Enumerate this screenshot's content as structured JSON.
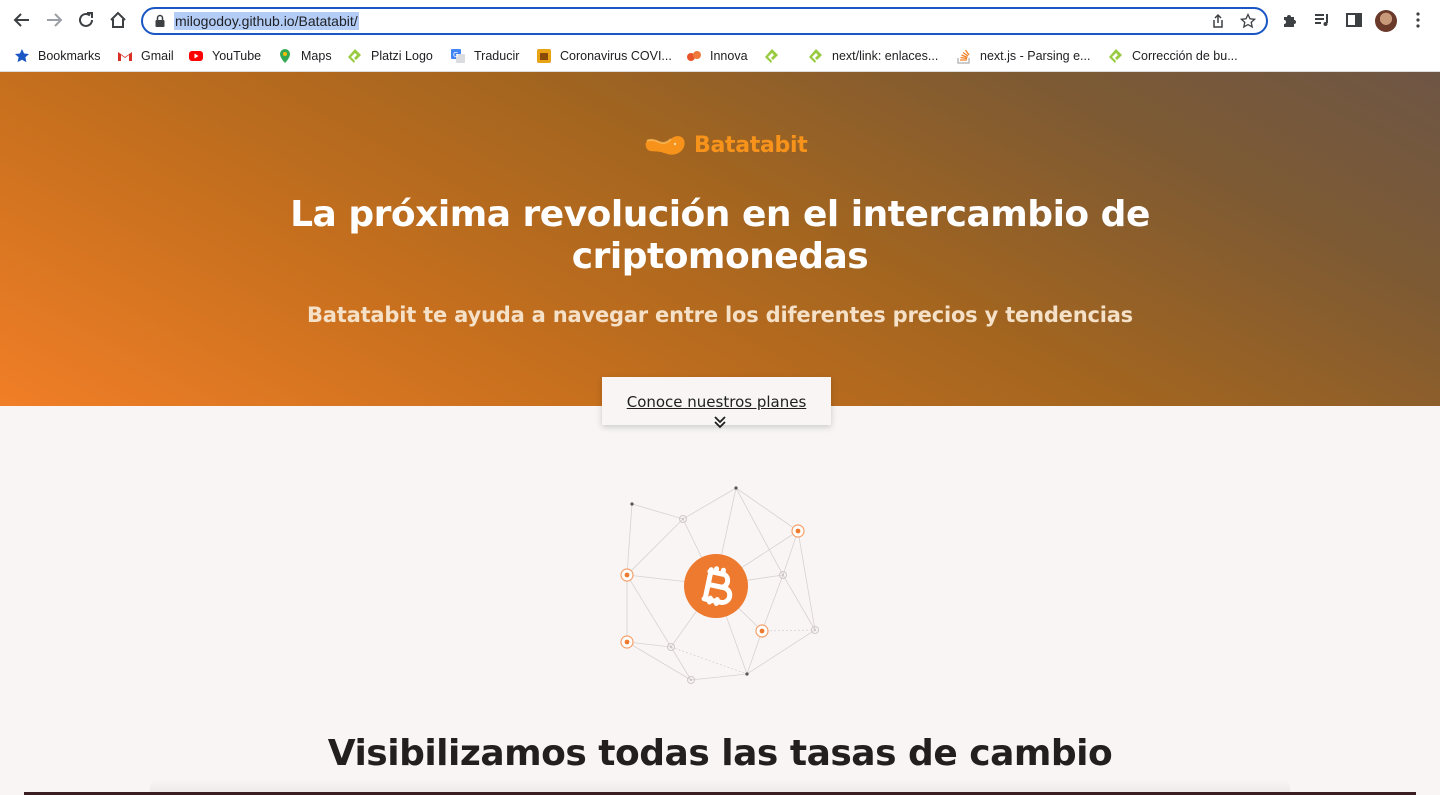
{
  "browser": {
    "url": "milogodoy.github.io/Batatabit/",
    "bookmarks": [
      {
        "label": "Bookmarks",
        "icon": "star-icon"
      },
      {
        "label": "Gmail",
        "icon": "gmail-icon"
      },
      {
        "label": "YouTube",
        "icon": "youtube-icon"
      },
      {
        "label": "Maps",
        "icon": "maps-icon"
      },
      {
        "label": "Platzi Logo",
        "icon": "platzi-icon"
      },
      {
        "label": "Traducir",
        "icon": "translate-icon"
      },
      {
        "label": "Coronavirus COVI...",
        "icon": "coronavirus-icon"
      },
      {
        "label": "Innova",
        "icon": "innova-icon"
      },
      {
        "label": "",
        "icon": "platzi-icon"
      },
      {
        "label": "next/link: enlaces...",
        "icon": "platzi-icon"
      },
      {
        "label": "next.js - Parsing e...",
        "icon": "stackoverflow-icon"
      },
      {
        "label": "Corrección de bu...",
        "icon": "platzi-icon"
      }
    ]
  },
  "hero": {
    "brand": "Batatabit",
    "title": "La próxima revolución en el intercambio de criptomonedas",
    "subtitle": "Batatabit te ayuda a navegar entre los diferentes precios y tendencias",
    "cta": "Conoce nuestros planes"
  },
  "main": {
    "section_title": "Visibilizamos todas las tasas de cambio"
  },
  "colors": {
    "accent": "#f7931a",
    "focus": "#1a56c4",
    "dark": "#231f1e"
  }
}
